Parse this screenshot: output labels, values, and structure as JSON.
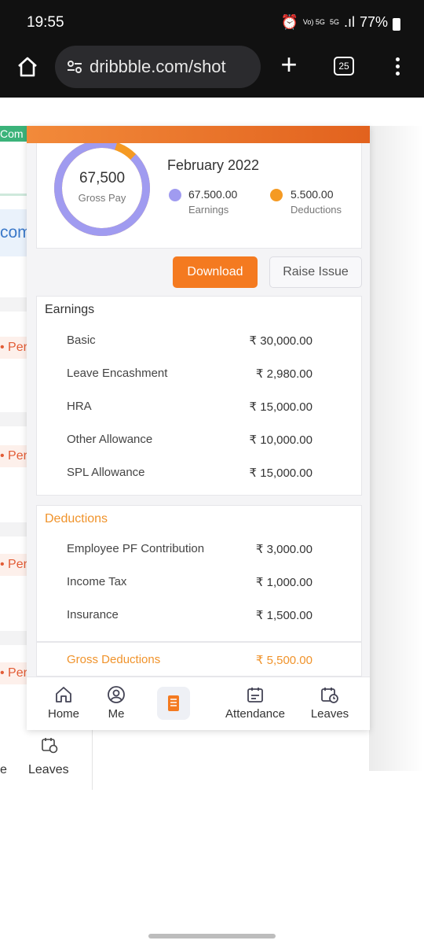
{
  "status_bar": {
    "time": "19:55",
    "network": "5G",
    "volte": "Vo) 5G",
    "battery": "77%"
  },
  "browser": {
    "url": "dribbble.com/shot",
    "tab_count": "25"
  },
  "background_page": {
    "green_tag": "Com",
    "blue_tag": "com",
    "per_tags": [
      "Per",
      "Per",
      "Per",
      "Per"
    ],
    "leaves_label": "Leaves",
    "dash": "e"
  },
  "summary": {
    "gross_value": "67,500",
    "gross_label": "Gross Pay",
    "month": "February 2022",
    "earnings_value": "67.500.00",
    "earnings_label": "Earnings",
    "deductions_value": "5.500.00",
    "deductions_label": "Deductions",
    "earnings_share": 0.925,
    "colors": {
      "earnings": "#a09bf0",
      "deductions": "#f59a23"
    }
  },
  "actions": {
    "download": "Download",
    "raise_issue": "Raise Issue"
  },
  "earnings": {
    "title": "Earnings",
    "rows": [
      {
        "label": "Basic",
        "value": "₹ 30,000.00"
      },
      {
        "label": "Leave Encashment",
        "value": "₹ 2,980.00"
      },
      {
        "label": "HRA",
        "value": "₹ 15,000.00"
      },
      {
        "label": "Other Allowance",
        "value": "₹ 10,000.00"
      },
      {
        "label": "SPL Allowance",
        "value": "₹ 15,000.00"
      }
    ]
  },
  "deductions": {
    "title": "Deductions",
    "rows": [
      {
        "label": "Employee PF Contribution",
        "value": "₹ 3,000.00"
      },
      {
        "label": "Income Tax",
        "value": "₹ 1,000.00"
      },
      {
        "label": "Insurance",
        "value": "₹ 1,500.00"
      }
    ],
    "gross_label": "Gross Deductions",
    "gross_value": "₹ 5,500.00"
  },
  "nav": {
    "home": "Home",
    "me": "Me",
    "attendance": "Attendance",
    "leaves": "Leaves"
  }
}
